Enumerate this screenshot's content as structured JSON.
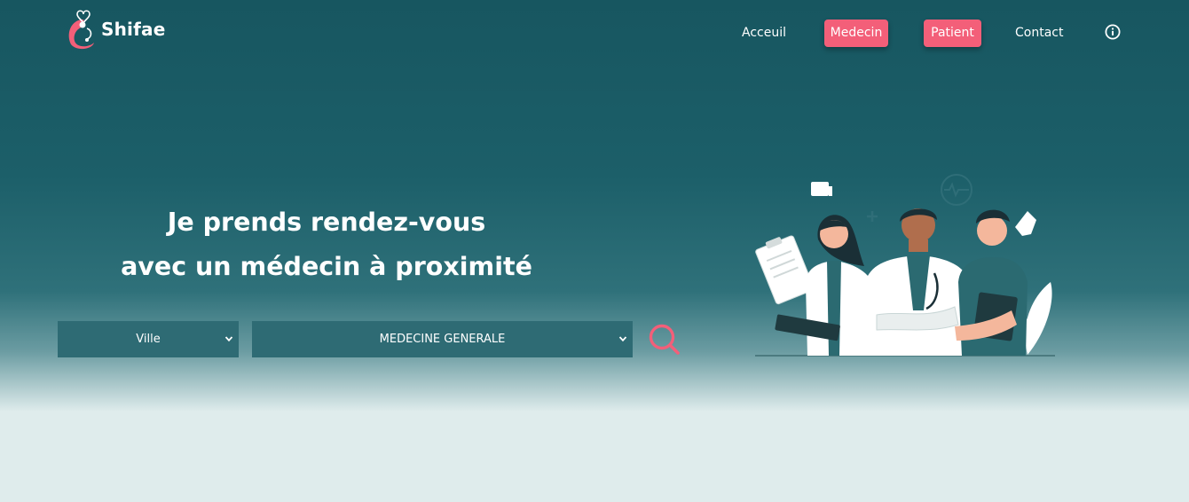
{
  "brand": {
    "name": "Shifae"
  },
  "nav": {
    "accueil": "Acceuil",
    "medecin": "Medecin",
    "patient": "Patient",
    "contact": "Contact",
    "info_icon": "info-circle-icon"
  },
  "hero": {
    "title_line1": "Je prends rendez-vous",
    "title_line2": "avec un médecin à proximité"
  },
  "search": {
    "city_selected": "Ville",
    "specialty_selected": "MEDECINE GENERALE",
    "search_icon": "search-icon"
  },
  "colors": {
    "accent": "#f35f79",
    "header_bg": "#175660",
    "select_bg": "#2e6b74",
    "page_bg": "#dfecec"
  },
  "illustration": {
    "icon": "doctors-illustration"
  }
}
